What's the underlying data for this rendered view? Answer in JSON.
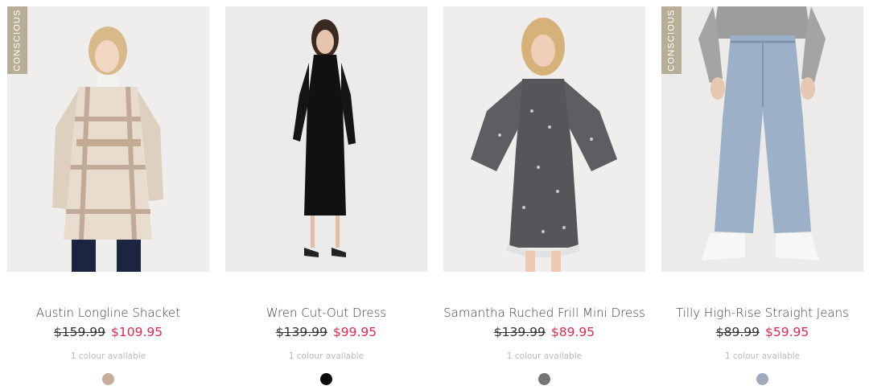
{
  "products": [
    {
      "badge": "CONSCIOUS",
      "name": "Austin Longline Shacket",
      "price_was": "$159.99",
      "price_now": "$109.95",
      "colours_text": "1 colour available",
      "swatch_color": "#c7ad99"
    },
    {
      "badge": "",
      "name": "Wren Cut-Out Dress",
      "price_was": "$139.99",
      "price_now": "$99.95",
      "colours_text": "1 colour available",
      "swatch_color": "#0a0a0a"
    },
    {
      "badge": "",
      "name": "Samantha Ruched Frill Mini Dress",
      "price_was": "$139.99",
      "price_now": "$89.95",
      "colours_text": "1 colour available",
      "swatch_color": "#767474"
    },
    {
      "badge": "CONSCIOUS",
      "name": "Tilly High-Rise Straight Jeans",
      "price_was": "$89.99",
      "price_now": "$59.95",
      "colours_text": "1 colour available",
      "swatch_color": "#9eaabb"
    }
  ],
  "colors": {
    "sale_price": "#e0284e",
    "badge_bg": "#b8ae98"
  }
}
